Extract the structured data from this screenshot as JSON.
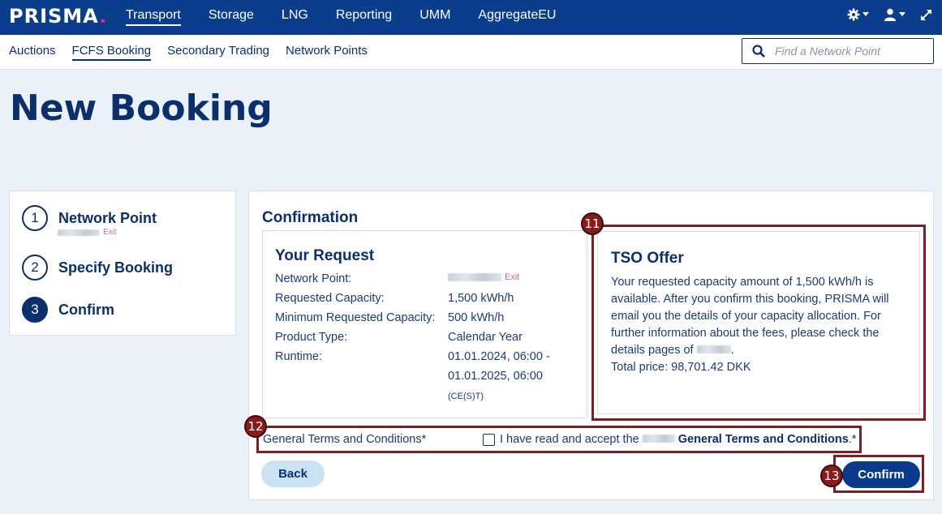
{
  "brand": {
    "name": "PRISMA",
    "dot": ".",
    "accent": "#e0297a"
  },
  "topnav": {
    "items": [
      "Transport",
      "Storage",
      "LNG",
      "Reporting",
      "UMM",
      "AggregateEU"
    ],
    "active": "Transport"
  },
  "subnav": {
    "items": [
      "Auctions",
      "FCFS Booking",
      "Secondary Trading",
      "Network Points"
    ],
    "active": "FCFS Booking"
  },
  "search": {
    "placeholder": "Find a Network Point"
  },
  "page": {
    "title": "New Booking"
  },
  "steps": [
    {
      "number": "1",
      "label": "Network Point",
      "sub": "Exit"
    },
    {
      "number": "2",
      "label": "Specify Booking"
    },
    {
      "number": "3",
      "label": "Confirm"
    }
  ],
  "confirmation": {
    "title": "Confirmation",
    "request": {
      "title": "Your Request",
      "rows": [
        {
          "label": "Network Point:",
          "value": "Exit"
        },
        {
          "label": "Requested Capacity:",
          "value": "1,500 kWh/h"
        },
        {
          "label": "Minimum Requested Capacity:",
          "value": "500 kWh/h"
        },
        {
          "label": "Product Type:",
          "value": "Calendar Year"
        },
        {
          "label": "Runtime:",
          "value": "01.01.2024, 06:00 -",
          "value2": "01.01.2025, 06:00",
          "value3": "(CE(S)T)"
        }
      ]
    },
    "offer": {
      "title": "TSO Offer",
      "text": "Your requested capacity amount of 1,500 kWh/h is available. After you confirm this booking, PRISMA will email you the details of your capacity allocation. For further information about the fees, please check the details pages of",
      "price": "Total price: 98,701.42 DKK"
    },
    "terms": {
      "label": "General Terms and Conditions*",
      "text_pre": "I have read and accept the",
      "text_link": "General Terms and Conditions",
      "text_post": ".*"
    },
    "back_label": "Back",
    "confirm_label": "Confirm"
  },
  "markers": [
    "11",
    "12",
    "13"
  ]
}
